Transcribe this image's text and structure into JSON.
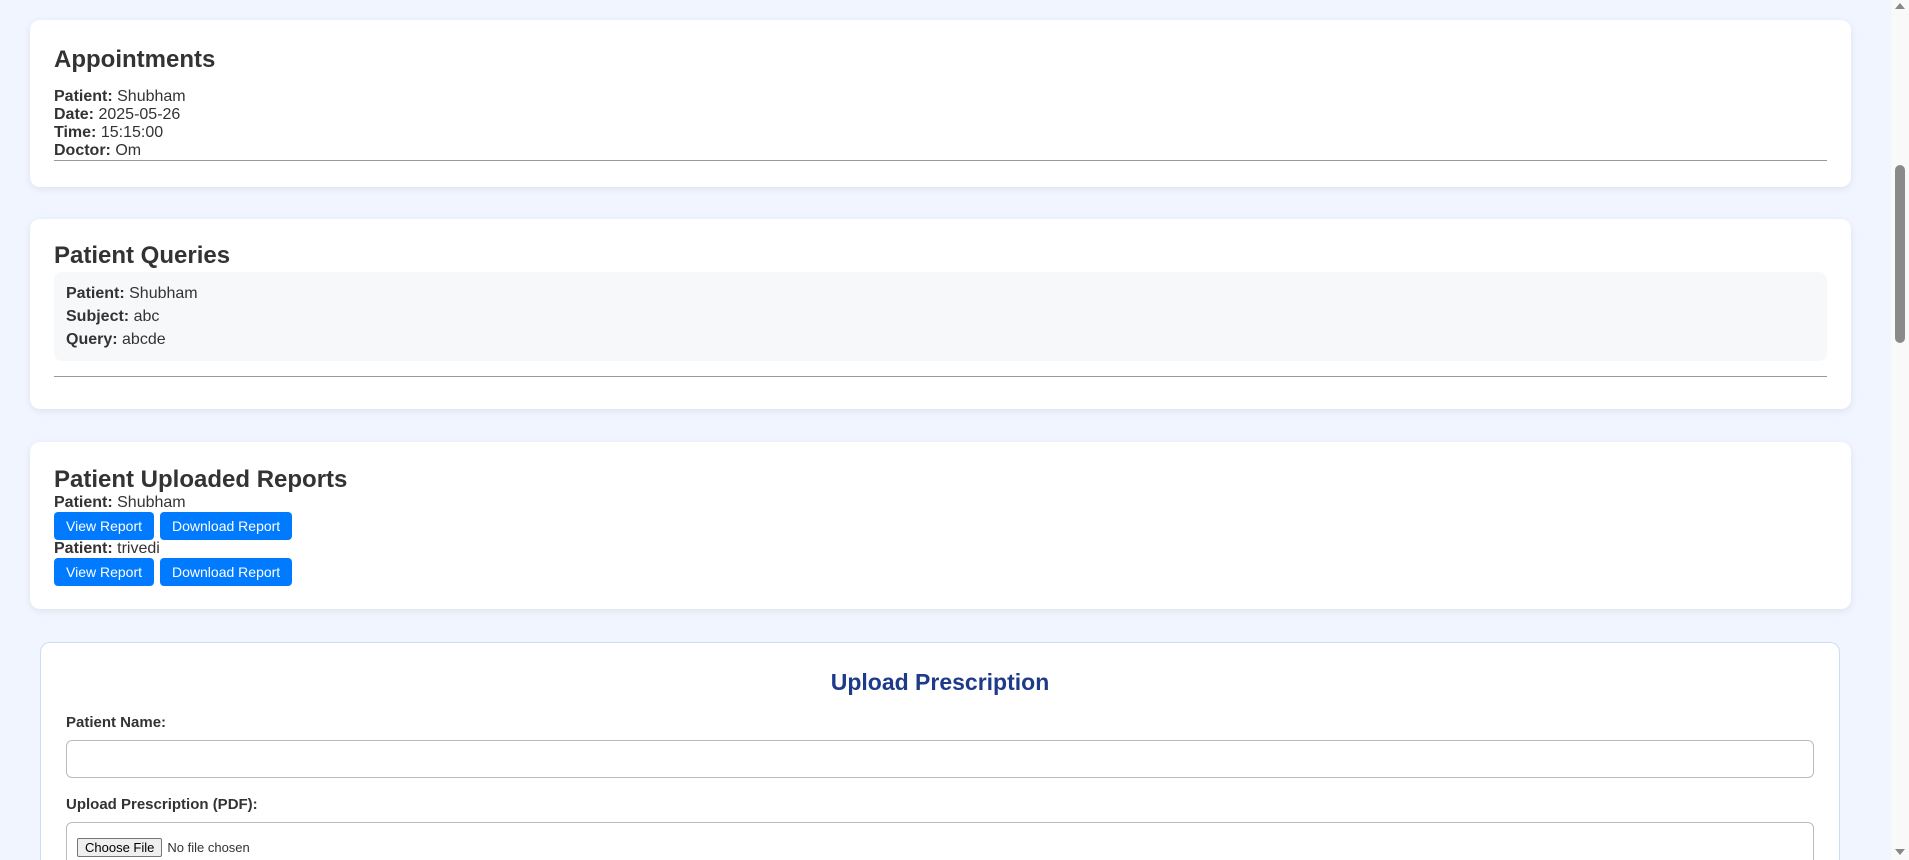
{
  "appointments": {
    "title": "Appointments",
    "items": [
      {
        "patient_label": "Patient:",
        "patient": "Shubham",
        "date_label": "Date:",
        "date": "2025-05-26",
        "time_label": "Time:",
        "time": "15:15:00",
        "doctor_label": "Doctor:",
        "doctor": "Om"
      }
    ]
  },
  "queries": {
    "title": "Patient Queries",
    "items": [
      {
        "patient_label": "Patient:",
        "patient": "Shubham",
        "subject_label": "Subject:",
        "subject": "abc",
        "query_label": "Query:",
        "query": "abcde"
      }
    ]
  },
  "reports": {
    "title": "Patient Uploaded Reports",
    "patient_label": "Patient:",
    "view_label": "View Report",
    "download_label": "Download Report",
    "items": [
      {
        "patient": "Shubham"
      },
      {
        "patient": "trivedi"
      }
    ]
  },
  "upload": {
    "title": "Upload Prescription",
    "name_label": "Patient Name:",
    "name_value": "",
    "file_label": "Upload Prescription (PDF):",
    "choose_file": "Choose File",
    "no_file": "No file chosen"
  },
  "colors": {
    "background": "#f0f5ff",
    "button": "#007bff",
    "upload_title": "#1e3a8a"
  }
}
